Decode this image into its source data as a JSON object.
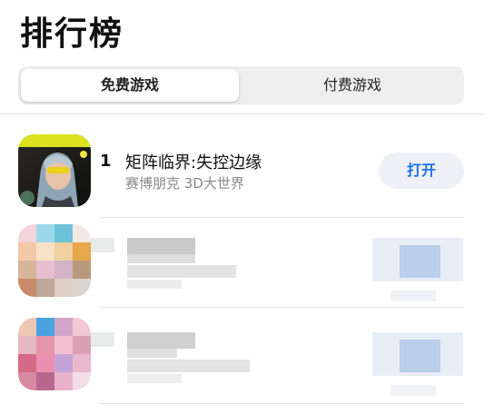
{
  "page": {
    "title": "排行榜"
  },
  "segmented": {
    "free": "免费游戏",
    "paid": "付费游戏",
    "selected": "免费游戏"
  },
  "apps": [
    {
      "rank": "1",
      "name": "矩阵临界:失控边缘",
      "subtitle": "赛博朋克 3D大世界",
      "action": "打开",
      "icon": "game-character-icon"
    }
  ],
  "colors": {
    "accent": "#1a73e8",
    "button_bg": "#eff0f5",
    "segment_bg": "#eeeeef",
    "subtitle": "#888888"
  }
}
